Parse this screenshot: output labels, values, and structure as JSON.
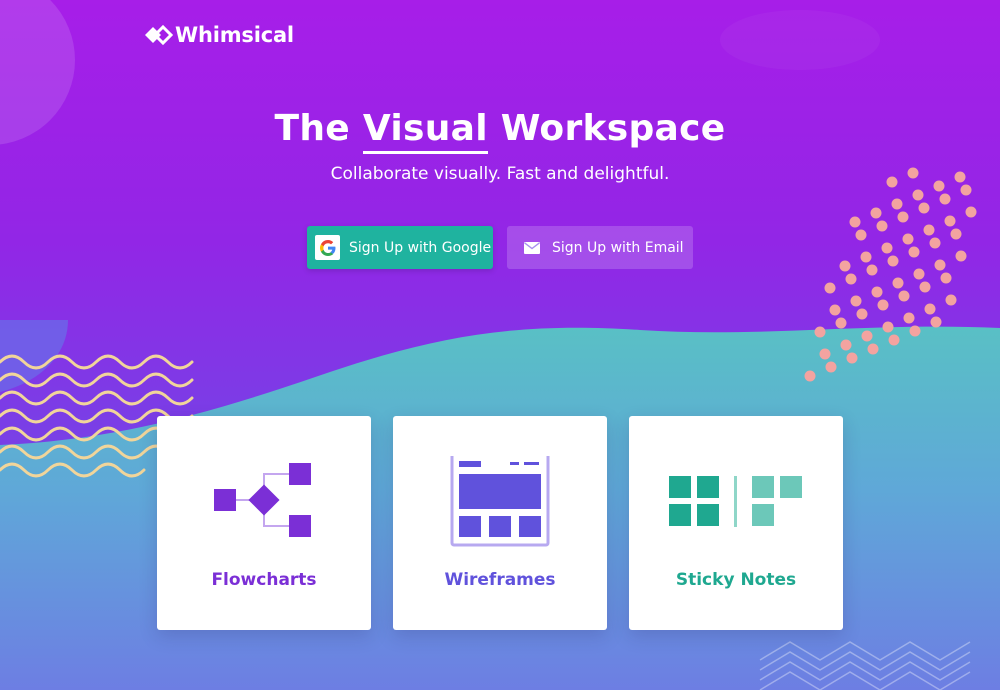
{
  "brand": {
    "name": "Whimsical"
  },
  "hero": {
    "title_before": "The ",
    "title_emphasis": "Visual",
    "title_after": " Workspace",
    "subtitle": "Collaborate visually. Fast and delightful."
  },
  "actions": {
    "google_label": "Sign Up with Google",
    "email_label": "Sign Up with Email"
  },
  "features": [
    {
      "label": "Flowcharts",
      "color": "#7b2fd6",
      "icon": "flowchart-icon"
    },
    {
      "label": "Wireframes",
      "color": "#6052dc",
      "icon": "wireframe-icon"
    },
    {
      "label": "Sticky Notes",
      "color": "#1fa890",
      "icon": "sticky-notes-icon"
    }
  ],
  "colors": {
    "google_button": "#1fb39f",
    "teal_band": "#5bbfca",
    "dots": "#f3a3a0",
    "waves": "#f1d59a"
  }
}
